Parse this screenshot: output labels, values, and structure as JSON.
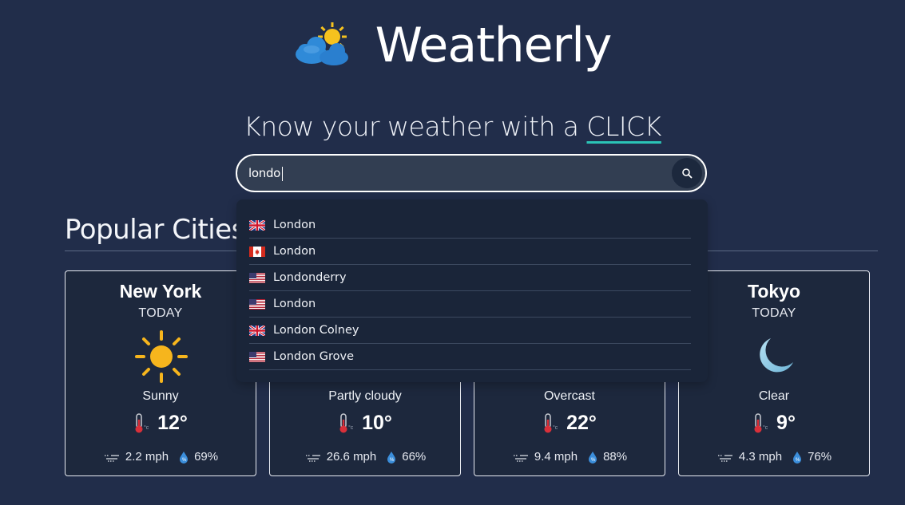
{
  "app": {
    "title": "Weatherly",
    "tagline_prefix": "Know your weather with a ",
    "tagline_highlight": "CLICK"
  },
  "search": {
    "value": "londo",
    "button_icon": "search-icon"
  },
  "suggestions": [
    {
      "name": "London",
      "flag": "uk-flag"
    },
    {
      "name": "London",
      "flag": "canada-flag"
    },
    {
      "name": "Londonderry",
      "flag": "us-flag"
    },
    {
      "name": "London",
      "flag": "us-flag"
    },
    {
      "name": "London Colney",
      "flag": "uk-flag"
    },
    {
      "name": "London Grove",
      "flag": "us-flag"
    }
  ],
  "popular": {
    "title": "Popular Cities",
    "cards": [
      {
        "city": "New York",
        "day": "TODAY",
        "icon": "sun-icon",
        "condition": "Sunny",
        "temp": "12°",
        "wind": "2.2 mph",
        "humidity": "69%"
      },
      {
        "city": "",
        "day": "",
        "icon": "partly-cloudy-icon",
        "condition": "Partly cloudy",
        "temp": "10°",
        "wind": "26.6 mph",
        "humidity": "66%"
      },
      {
        "city": "",
        "day": "",
        "icon": "overcast-icon",
        "condition": "Overcast",
        "temp": "22°",
        "wind": "9.4 mph",
        "humidity": "88%"
      },
      {
        "city": "Tokyo",
        "day": "TODAY",
        "icon": "moon-icon",
        "condition": "Clear",
        "temp": "9°",
        "wind": "4.3 mph",
        "humidity": "76%"
      }
    ]
  },
  "colors": {
    "background": "#212d4a",
    "accent_underline": "#2bc3b6",
    "card_background": "#1d283d",
    "sun": "#f6b51d",
    "moon": "#8fcbe4"
  }
}
